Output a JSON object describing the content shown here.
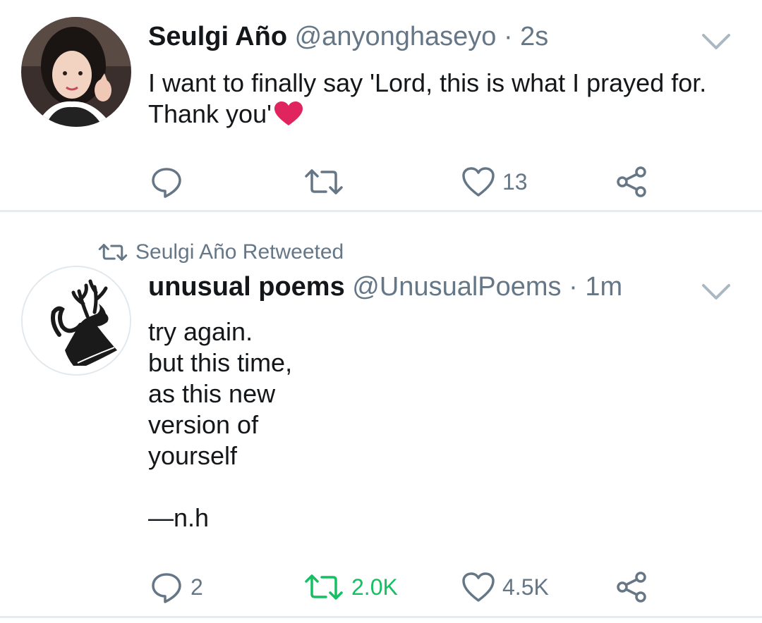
{
  "tweets": [
    {
      "author_name": "Seulgi Año",
      "handle": "@anyonghaseyo",
      "separator": "·",
      "time": "2s",
      "text": "I want to finally say 'Lord, this is what I prayed for. Thank you'",
      "emoji": "red-heart",
      "actions": {
        "replies": "",
        "retweets": "",
        "likes": "13"
      }
    },
    {
      "retweeted_by": "Seulgi Año Retweeted",
      "author_name": "unusual poems",
      "handle": "@UnusualPoems",
      "separator": "·",
      "time": "1m",
      "text": "try again.\nbut this time,\nas this new\nversion of\nyourself\n\n—n.h",
      "actions": {
        "replies": "2",
        "retweets": "2.0K",
        "likes": "4.5K"
      },
      "retweeted_state_color": "#17bf63"
    }
  ],
  "colors": {
    "muted": "#657786",
    "heart": "#e0245e",
    "retweet_active": "#17bf63"
  }
}
